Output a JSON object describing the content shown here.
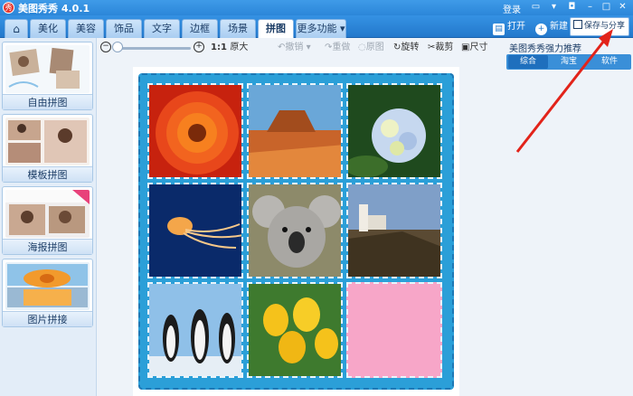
{
  "window": {
    "title": "美图秀秀 4.0.1",
    "login": "登录"
  },
  "tabs": [
    "美化",
    "美容",
    "饰品",
    "文字",
    "边框",
    "场景",
    "拼图",
    "更多功能"
  ],
  "toolbar_right": {
    "open": "打开",
    "new": "新建",
    "save_share": "保存与分享"
  },
  "left_panel": [
    {
      "label": "自由拼图"
    },
    {
      "label": "模板拼图"
    },
    {
      "label": "海报拼图"
    },
    {
      "label": "图片拼接"
    }
  ],
  "toolbar": {
    "original_size_label": "1:1",
    "original_size_text": "原大",
    "undo": "撤销",
    "redo": "重做",
    "reset": "原图",
    "rotate": "旋转",
    "crop": "裁剪",
    "resize": "尺寸"
  },
  "right_panel": {
    "title": "美图秀秀强力推荐",
    "tabs": [
      "综合",
      "淘宝",
      "软件"
    ]
  },
  "colors": {
    "accent": "#2b86d9",
    "frame": "#2b9fd8",
    "pink_cell": "#f7a6c8"
  },
  "icons": {
    "home": "home-icon",
    "open": "folder-icon",
    "new": "plus-circle-icon",
    "save": "save-icon"
  }
}
